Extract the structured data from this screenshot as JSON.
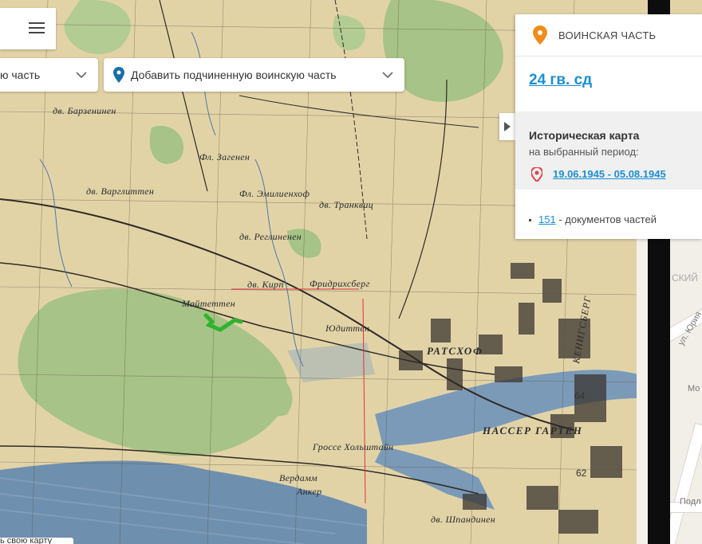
{
  "menu": {
    "icon": "hamburger-icon"
  },
  "selects": {
    "primary": {
      "label": "ю часть",
      "icon": "chevron-down-icon"
    },
    "secondary": {
      "label": "Добавить подчиненную воинскую часть",
      "icon": "chevron-down-icon",
      "pin_icon": "location-pin-icon"
    }
  },
  "panel": {
    "header_title": "ВОИНСКАЯ ЧАСТЬ",
    "unit_name": "24 гв. сд",
    "historic_title": "Историческая карта",
    "historic_subtitle": "на выбранный период:",
    "date_range": "19.06.1945 - 05.08.1945",
    "docs_count": "151",
    "docs_text": " - документов частей"
  },
  "map_labels": {
    "barzenen": "дв. Барзенинен",
    "vargliten": "дв. Варглиттен",
    "zagenen": "Фл. Загенен",
    "emil": "Фл. Эмилиенхоф",
    "trankvits": "дв. Транквиц",
    "reglinen": "дв. Реглиненен",
    "maiterhen": "Майтеттен",
    "kirp": "дв. Кирп",
    "friedrichsberg": "Фридрихсберг",
    "juditten": "Юдиттен",
    "ratshof": "РАТСХОФ",
    "konigsberg": "КЕНИГСБЕРГ",
    "nasser_garten": "НАССЕР ГАРТЕН",
    "gross_holstein": "Гроссе Хольштайн",
    "verdamm": "Вердамм",
    "anker": "Анкер",
    "shpandinen": "дв. Шпандинен",
    "modern_city": "СКИЙ",
    "modern_street": "ул. Юрия",
    "modern_mo": "Мо",
    "modern_podl": "Подл",
    "bottom_link": "ь свою карту"
  },
  "grid_numbers": {
    "n64": "64",
    "n62": "62"
  },
  "colors": {
    "accent": "#1a8fd6",
    "orange_pin": "#f08c1a",
    "red_pin": "#e0404a",
    "panel_bg": "#ffffff",
    "map_paper": "#e8dcb5",
    "forest": "#9bbd7a",
    "water": "#6f8fae"
  }
}
